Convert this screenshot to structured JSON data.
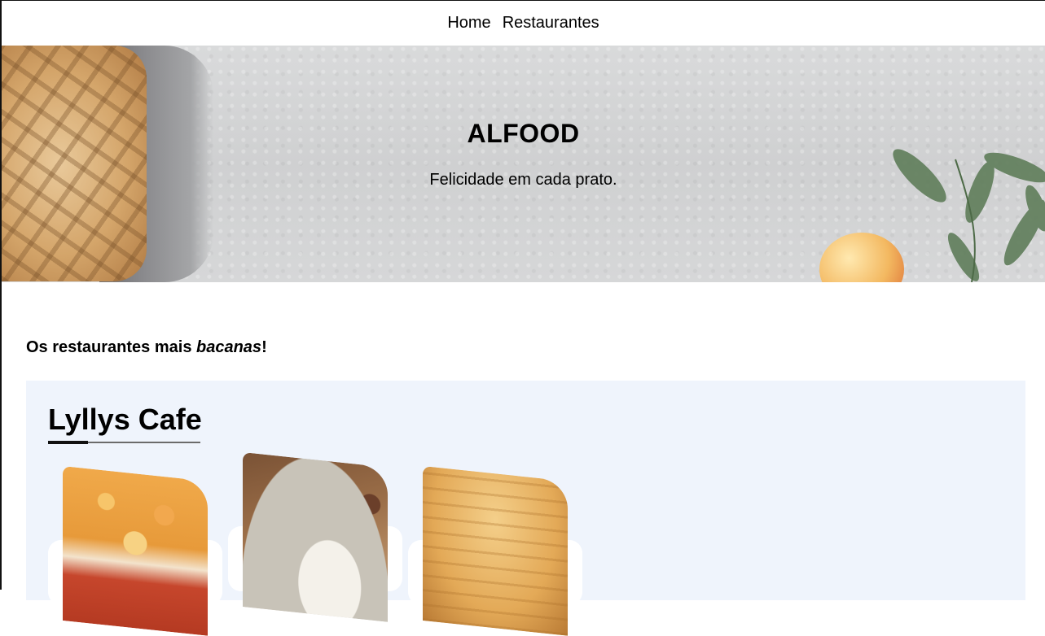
{
  "nav": {
    "items": [
      {
        "label": "Home"
      },
      {
        "label": "Restaurantes"
      }
    ]
  },
  "hero": {
    "title": "ALFOOD",
    "subtitle": "Felicidade em cada prato."
  },
  "section": {
    "heading_prefix": "Os restaurantes mais ",
    "heading_emphasis": "bacanas",
    "heading_suffix": "!"
  },
  "restaurant": {
    "name": "Lyllys Cafe",
    "dishes": [
      {
        "image": "lasagna-photo"
      },
      {
        "image": "rice-plate-photo"
      },
      {
        "image": "savory-pie-photo"
      }
    ]
  }
}
